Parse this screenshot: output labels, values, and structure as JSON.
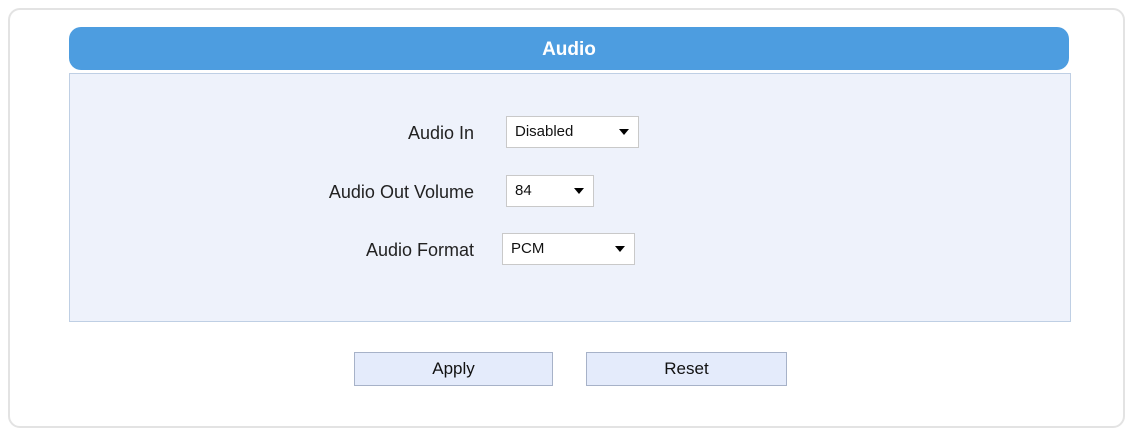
{
  "section": {
    "title": "Audio"
  },
  "fields": {
    "audio_in": {
      "label": "Audio In",
      "value": "Disabled"
    },
    "audio_out_volume": {
      "label": "Audio Out Volume",
      "value": "84"
    },
    "audio_format": {
      "label": "Audio Format",
      "value": "PCM"
    }
  },
  "buttons": {
    "apply_label": "Apply",
    "reset_label": "Reset"
  },
  "icons": {
    "dropdown": "chevron-down-icon"
  },
  "colors": {
    "header_bg": "#4d9de0",
    "body_bg": "#eef2fb",
    "button_bg": "#e4ebfb"
  }
}
